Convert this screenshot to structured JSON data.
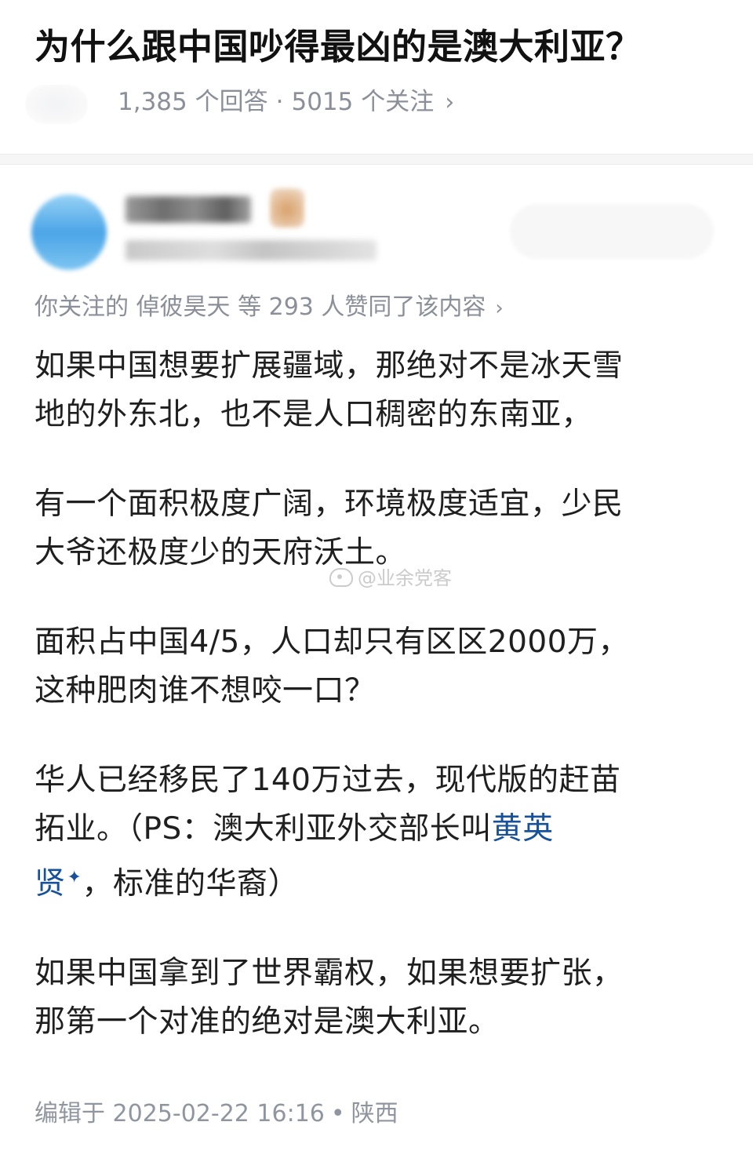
{
  "question": {
    "title": "为什么跟中国吵得最凶的是澳大利亚？",
    "answers_count": "1,385 个回答",
    "separator": "·",
    "followers_count": "5015 个关注",
    "chevron": "›"
  },
  "answer": {
    "upvote_text": "你关注的 倬彼昊天 等 293 人赞同了该内容",
    "chevron": "›",
    "paragraphs": [
      {
        "lines": [
          "如果中国想要扩展疆域，那绝对不是冰天雪",
          "地的外东北，也不是人口稠密的东南亚，"
        ]
      },
      {
        "lines": [
          "有一个面积极度广阔，环境极度适宜，少民",
          "大爷还极度少的天府沃土。"
        ]
      },
      {
        "lines": [
          "面积占中国4/5，人口却只有区区2000万，",
          "这种肥肉谁不想咬一口？"
        ]
      },
      {
        "line1": "华人已经移民了140万过去，现代版的赶苗",
        "line2_pre": "拓业。（PS：澳大利亚外交部长叫",
        "line2_link": "黄英",
        "line3_link": "贤",
        "link_marker": "✦",
        "line3_post": "，标准的华裔）"
      },
      {
        "lines": [
          "如果中国拿到了世界霸权，如果想要扩张，",
          "那第一个对准的绝对是澳大利亚。"
        ]
      }
    ],
    "edit_meta": {
      "label": "编辑于 2025-02-22 16:16",
      "dot": "•",
      "location": "陕西"
    }
  },
  "watermark": {
    "text": "@业余党客",
    "icon": "weibo-icon"
  },
  "colors": {
    "link": "#175199",
    "meta_gray": "#8b8f99",
    "body_text": "#1f1f1f"
  }
}
